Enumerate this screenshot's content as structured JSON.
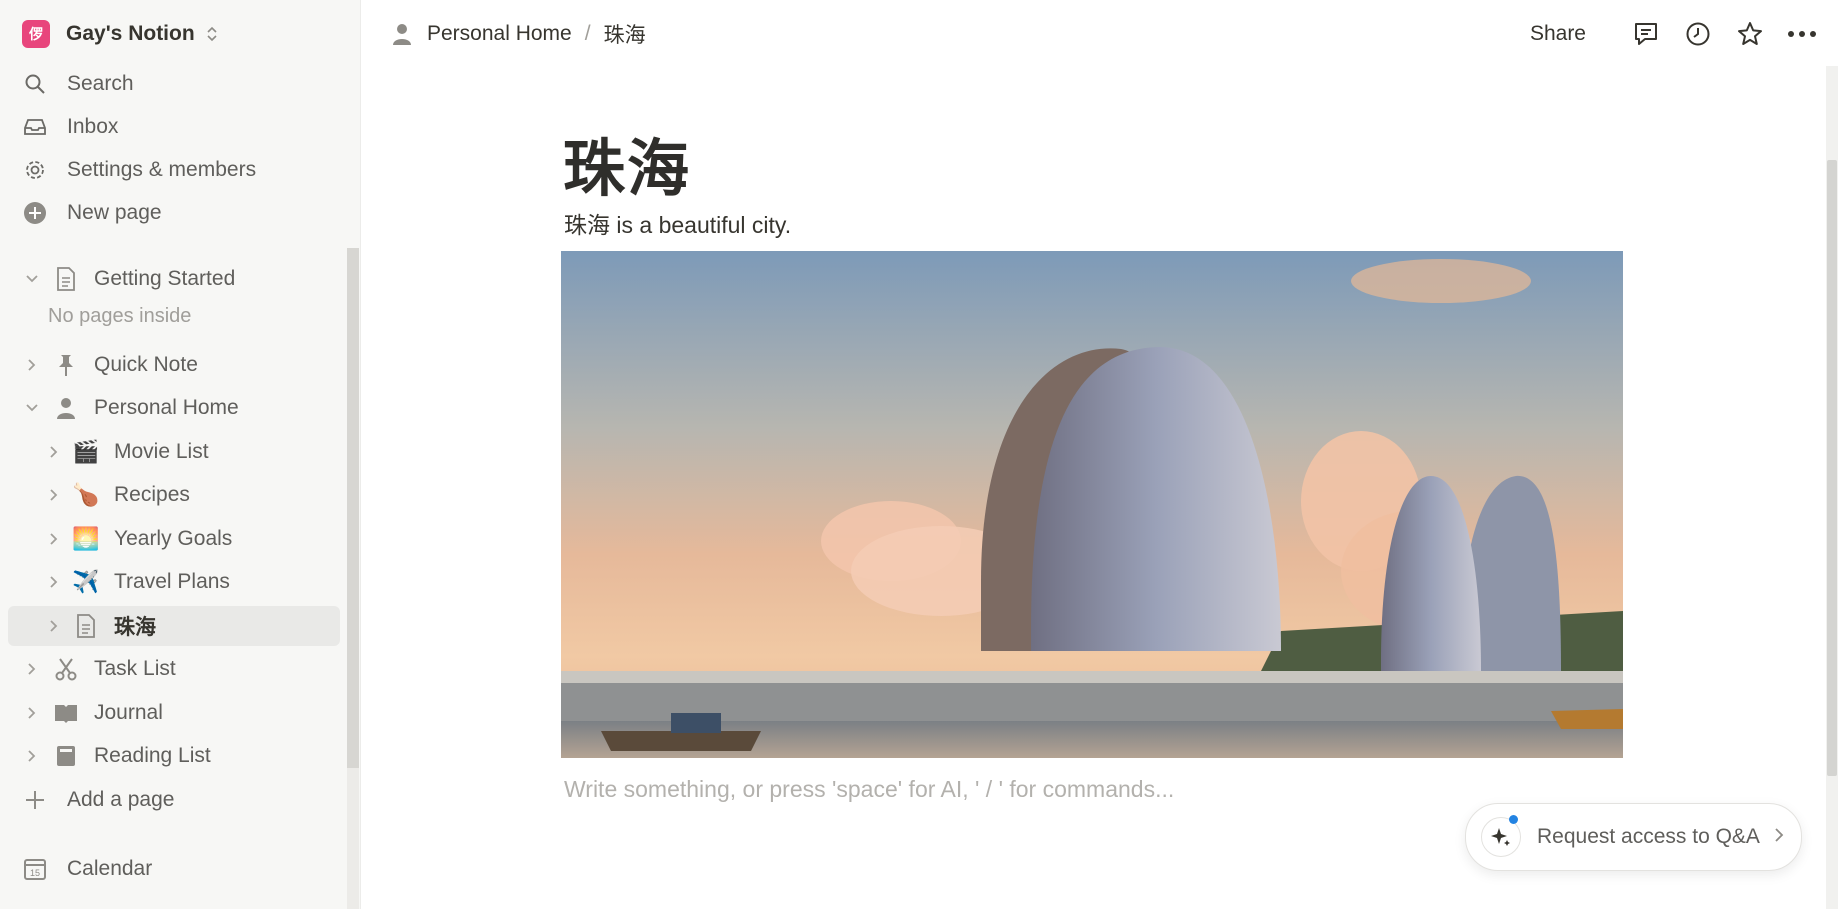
{
  "workspace": {
    "name": "Gay's Notion",
    "logo_glyph": "㑩",
    "logo_color": "#e8457c"
  },
  "sidebar": {
    "nav": [
      {
        "label": "Search",
        "icon": "search-icon"
      },
      {
        "label": "Inbox",
        "icon": "inbox-icon"
      },
      {
        "label": "Settings & members",
        "icon": "gear-icon"
      },
      {
        "label": "New page",
        "icon": "plus-circle-icon"
      }
    ],
    "pages": [
      {
        "label": "Getting Started",
        "icon": "document-icon",
        "expanded": true
      },
      {
        "label": "Quick Note",
        "icon": "pin-icon"
      },
      {
        "label": "Personal Home",
        "icon": "person-icon",
        "expanded": true
      },
      {
        "label": "Movie List",
        "icon": "🎬"
      },
      {
        "label": "Recipes",
        "icon": "🍗"
      },
      {
        "label": "Yearly Goals",
        "icon": "🌅"
      },
      {
        "label": "Travel Plans",
        "icon": "✈️"
      },
      {
        "label": "珠海",
        "icon": "document-icon",
        "active": true
      },
      {
        "label": "Task List",
        "icon": "scissors-icon"
      },
      {
        "label": "Journal",
        "icon": "book-icon"
      },
      {
        "label": "Reading List",
        "icon": "notebook-icon"
      }
    ],
    "empty_note": "No pages inside",
    "add_page": "Add a page",
    "calendar": "Calendar",
    "calendar_day": "15"
  },
  "breadcrumb": {
    "parent": "Personal Home",
    "separator": "/",
    "current": "珠海"
  },
  "topbar": {
    "share": "Share"
  },
  "page": {
    "title": "珠海",
    "paragraph": "珠海 is a beautiful city.",
    "placeholder": "Write something, or press 'space' for AI, ' / ' for commands..."
  },
  "qa": {
    "label": "Request access to Q&A"
  }
}
